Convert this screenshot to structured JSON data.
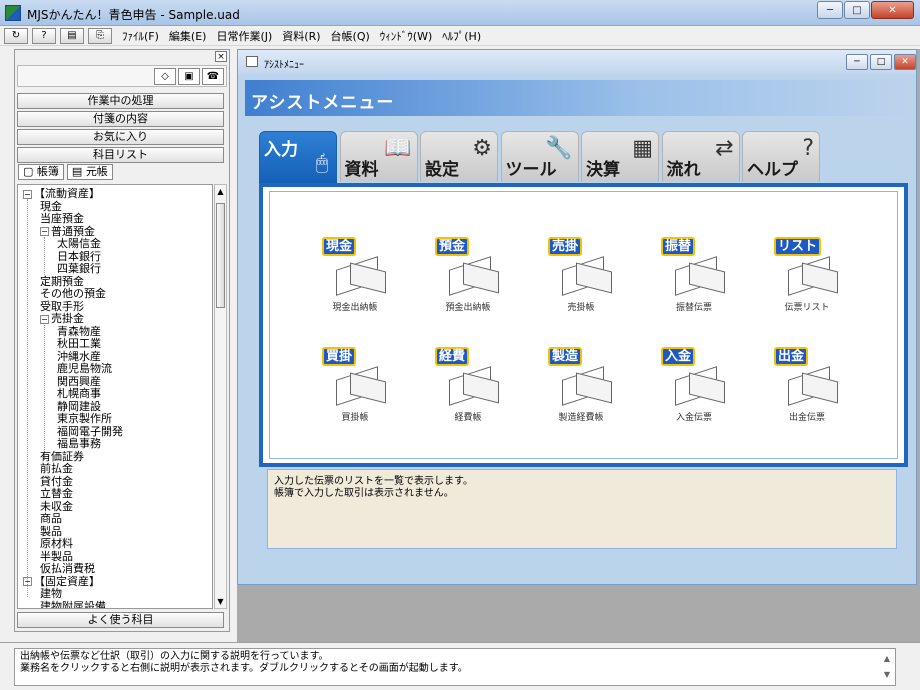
{
  "window": {
    "title": "MJSかんたん！青色申告 - Sample.uad",
    "min": "─",
    "max": "□",
    "close": "✕"
  },
  "menubar": {
    "items": [
      "ﾌｧｲﾙ(F)",
      "編集(E)",
      "日常作業(J)",
      "資料(R)",
      "台帳(Q)",
      "ｳｨﾝﾄﾞｳ(W)",
      "ﾍﾙﾌﾟ(H)"
    ],
    "tool_icons": [
      "↻",
      "?",
      "▤",
      "⎘"
    ]
  },
  "leftpane": {
    "close": "×",
    "tool_icons": [
      "◇",
      "▣",
      "☎"
    ],
    "buttons": [
      "作業中の処理",
      "付箋の内容",
      "お気に入り",
      "科目リスト"
    ],
    "tabs": [
      "帳簿",
      "元帳"
    ],
    "tab_icons": [
      "▢",
      "▤"
    ],
    "bottom_button": "よく使う科目",
    "tree": [
      {
        "label": "【流動資産】",
        "level": 0,
        "exp": "−"
      },
      {
        "label": "現金",
        "level": 1
      },
      {
        "label": "当座預金",
        "level": 1
      },
      {
        "label": "普通預金",
        "level": 1,
        "exp": "−"
      },
      {
        "label": "太陽信金",
        "level": 2
      },
      {
        "label": "日本銀行",
        "level": 2
      },
      {
        "label": "四葉銀行",
        "level": 2
      },
      {
        "label": "定期預金",
        "level": 1
      },
      {
        "label": "その他の預金",
        "level": 1
      },
      {
        "label": "受取手形",
        "level": 1
      },
      {
        "label": "売掛金",
        "level": 1,
        "exp": "−"
      },
      {
        "label": "青森物産",
        "level": 2
      },
      {
        "label": "秋田工業",
        "level": 2
      },
      {
        "label": "沖縄水産",
        "level": 2
      },
      {
        "label": "鹿児島物流",
        "level": 2
      },
      {
        "label": "関西興産",
        "level": 2
      },
      {
        "label": "札幌商事",
        "level": 2
      },
      {
        "label": "静岡建設",
        "level": 2
      },
      {
        "label": "東京製作所",
        "level": 2
      },
      {
        "label": "福岡電子開発",
        "level": 2
      },
      {
        "label": "福島事務",
        "level": 2
      },
      {
        "label": "有価証券",
        "level": 1
      },
      {
        "label": "前払金",
        "level": 1
      },
      {
        "label": "貸付金",
        "level": 1
      },
      {
        "label": "立替金",
        "level": 1
      },
      {
        "label": "未収金",
        "level": 1
      },
      {
        "label": "商品",
        "level": 1
      },
      {
        "label": "製品",
        "level": 1
      },
      {
        "label": "原材料",
        "level": 1
      },
      {
        "label": "半製品",
        "level": 1
      },
      {
        "label": "仮払消費税",
        "level": 1
      },
      {
        "label": "【固定資産】",
        "level": 0,
        "exp": "−"
      },
      {
        "label": "建物",
        "level": 1
      },
      {
        "label": "建物附属設備",
        "level": 1
      }
    ]
  },
  "mdi": {
    "title": "ｱｼｽﾄﾒﾆｭｰ",
    "banner": "アシストメニュー",
    "tabs": [
      {
        "label": "入力",
        "icon": "🖱"
      },
      {
        "label": "資料",
        "icon": "📖"
      },
      {
        "label": "設定",
        "icon": "⚙"
      },
      {
        "label": "ツール",
        "icon": "🔧"
      },
      {
        "label": "決算",
        "icon": "▦"
      },
      {
        "label": "流れ",
        "icon": "⇄"
      },
      {
        "label": "ヘルプ",
        "icon": "?"
      }
    ],
    "items": [
      {
        "head": "現金",
        "label": "現金出納帳"
      },
      {
        "head": "預金",
        "label": "預金出納帳"
      },
      {
        "head": "売掛",
        "label": "売掛帳"
      },
      {
        "head": "振替",
        "label": "振替伝票"
      },
      {
        "head": "リスト",
        "label": "伝票リスト"
      },
      {
        "head": "買掛",
        "label": "買掛帳"
      },
      {
        "head": "経費",
        "label": "経費帳"
      },
      {
        "head": "製造",
        "label": "製造経費帳"
      },
      {
        "head": "入金",
        "label": "入金伝票"
      },
      {
        "head": "出金",
        "label": "出金伝票"
      }
    ],
    "description": [
      "入力した伝票のリストを一覧で表示します。",
      "帳簿で入力した取引は表示されません。"
    ]
  },
  "status": {
    "lines": [
      "出納帳や伝票など仕訳（取引）の入力に関する説明を行っています。",
      "業務名をクリックすると右側に説明が表示されます。ダブルクリックするとその画面が起動します。"
    ]
  }
}
